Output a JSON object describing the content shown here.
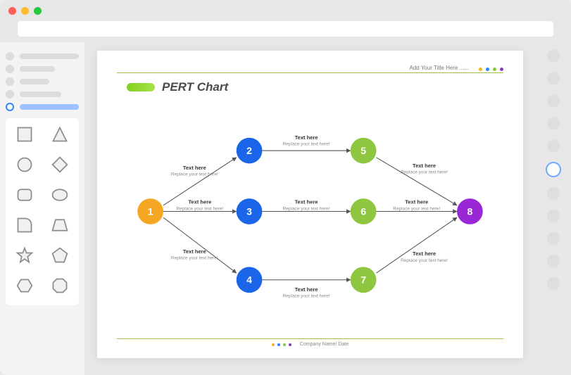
{
  "header": {
    "title_prompt": "Add Your Title Here ......"
  },
  "title": "PERT Chart",
  "accent_dots": [
    "#f0b51f",
    "#2f86ff",
    "#8ec63f",
    "#8a3cc1"
  ],
  "nodes": [
    {
      "id": "1",
      "color": "#f5a623"
    },
    {
      "id": "2",
      "color": "#1b66e8"
    },
    {
      "id": "3",
      "color": "#1b66e8"
    },
    {
      "id": "4",
      "color": "#1b66e8"
    },
    {
      "id": "5",
      "color": "#8ec63f"
    },
    {
      "id": "6",
      "color": "#8ec63f"
    },
    {
      "id": "7",
      "color": "#8ec63f"
    },
    {
      "id": "8",
      "color": "#9a27d6"
    }
  ],
  "edge_label": {
    "title": "Text here",
    "sub": "Replace your text here!"
  },
  "footer": {
    "company": "Company Name/ Date"
  },
  "chart_data": {
    "type": "pert-network",
    "nodes": [
      1,
      2,
      3,
      4,
      5,
      6,
      7,
      8
    ],
    "edges": [
      {
        "from": 1,
        "to": 2
      },
      {
        "from": 1,
        "to": 3
      },
      {
        "from": 1,
        "to": 4
      },
      {
        "from": 2,
        "to": 5
      },
      {
        "from": 3,
        "to": 6
      },
      {
        "from": 4,
        "to": 7
      },
      {
        "from": 5,
        "to": 8
      },
      {
        "from": 6,
        "to": 8
      },
      {
        "from": 7,
        "to": 8
      }
    ],
    "edge_placeholder": {
      "title": "Text here",
      "sub": "Replace your text here!"
    }
  }
}
